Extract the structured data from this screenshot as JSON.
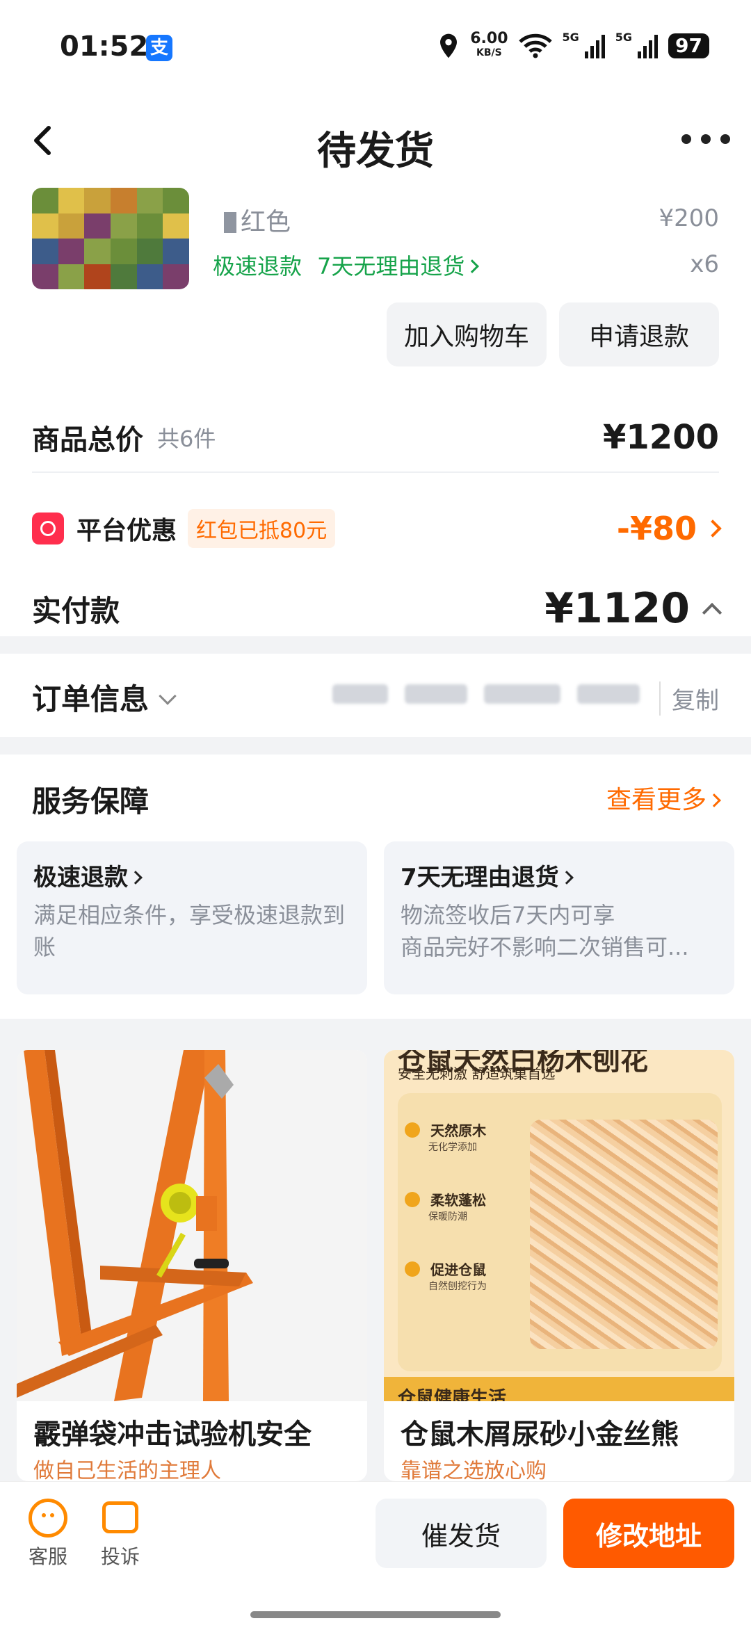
{
  "statusbar": {
    "time": "01:52",
    "app_badge": "支",
    "net_speed": "6.00",
    "net_unit": "KB/S",
    "sig1": "5G",
    "sig2": "5G",
    "battery": "97"
  },
  "header": {
    "title": "待发货"
  },
  "product": {
    "variant": "红色",
    "price": "¥200",
    "qty": "x6",
    "tag1": "极速退款",
    "tag2": "7天无理由退货",
    "add_cart": "加入购物车",
    "refund": "申请退款"
  },
  "summary": {
    "total_label": "商品总价",
    "total_count": "共6件",
    "total_value": "¥1200",
    "discount_label": "平台优惠",
    "discount_badge": "红包已抵80元",
    "discount_value": "-¥80",
    "paid_label": "实付款",
    "paid_value": "¥1120"
  },
  "order": {
    "title": "订单信息",
    "copy": "复制"
  },
  "service": {
    "title": "服务保障",
    "more": "查看更多",
    "box1_title": "极速退款",
    "box1_desc": "满足相应条件，享受极速退款到账",
    "box2_title": "7天无理由退货",
    "box2_line1": "物流签收后7天内可享",
    "box2_line2": "商品完好不影响二次销售可..."
  },
  "recommend": [
    {
      "title": "霰弹袋冲击试验机安全",
      "subtitle": "做自己生活的主理人"
    },
    {
      "title": "仓鼠木屑尿砂小金丝熊",
      "subtitle": "靠谱之选放心购",
      "img_head": "仓鼠天然白杨木刨花",
      "img_tagline": "安全无刺激 舒适筑巢首选",
      "features": [
        {
          "main": "天然原木",
          "sub": "无化学添加"
        },
        {
          "main": "柔软蓬松",
          "sub": "保暖防潮"
        },
        {
          "main": "促进仓鼠",
          "sub": "自然刨挖行为"
        }
      ],
      "img_foot": "仓鼠健康生活"
    }
  ],
  "bottom": {
    "kefu": "客服",
    "tousu": "投诉",
    "urge": "催发货",
    "address": "修改地址"
  },
  "colors": {
    "accent": "#ff5a00",
    "green": "#16a34a",
    "bg": "#f2f3f5"
  }
}
